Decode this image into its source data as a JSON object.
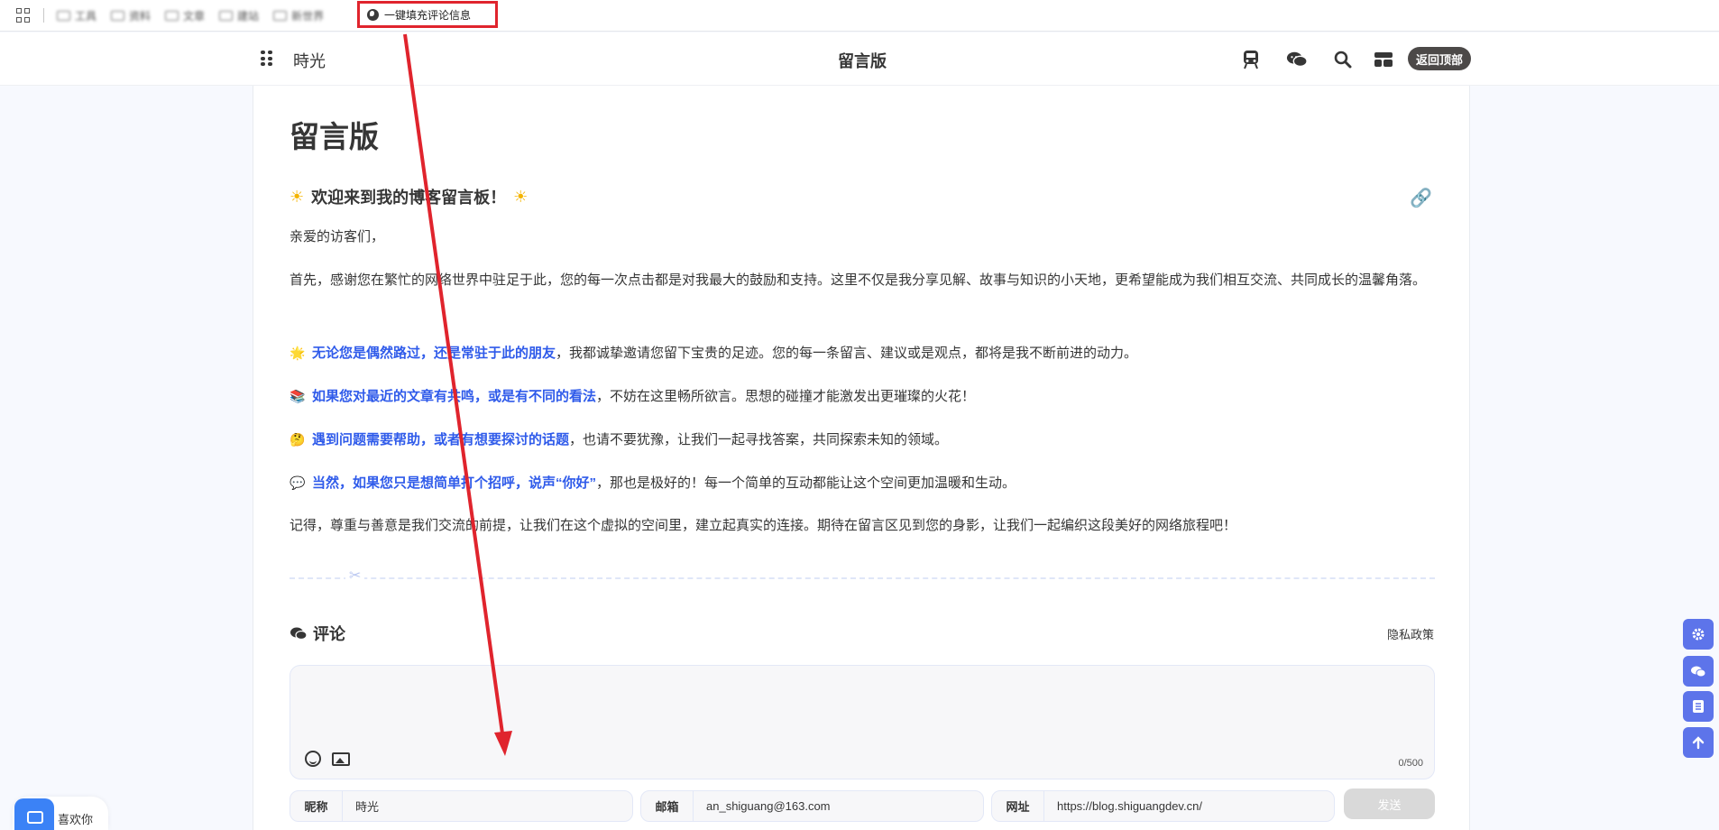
{
  "bookmarks": {
    "blurred_items": [
      "工具",
      "资料",
      "文章",
      "建站",
      "新世界"
    ],
    "fill_button_label": "一键填充评论信息"
  },
  "nav": {
    "brand": "時光",
    "title": "留言版",
    "top_button": "返回顶部"
  },
  "content": {
    "page_title": "留言版",
    "heading": "欢迎来到我的博客留言板！",
    "greeting": "亲爱的访客们，",
    "intro": "首先，感谢您在繁忙的网络世界中驻足于此，您的每一次点击都是对我最大的鼓励和支持。这里不仅是我分享见解、故事与知识的小天地，更希望能成为我们相互交流、共同成长的温馨角落。",
    "items": [
      {
        "icon": "🌟",
        "em": "无论您是偶然路过，还是常驻于此的朋友",
        "rest": "，我都诚挚邀请您留下宝贵的足迹。您的每一条留言、建议或是观点，都将是我不断前进的动力。"
      },
      {
        "icon": "📚",
        "em": "如果您对最近的文章有共鸣，或是有不同的看法",
        "rest": "，不妨在这里畅所欲言。思想的碰撞才能激发出更璀璨的火花！"
      },
      {
        "icon": "🤔",
        "em": "遇到问题需要帮助，或者有想要探讨的话题",
        "rest": "，也请不要犹豫，让我们一起寻找答案，共同探索未知的领域。"
      },
      {
        "icon": "💬",
        "em": "当然，如果您只是想简单打个招呼，说声“你好”",
        "rest": "，那也是极好的！每一个简单的互动都能让这个空间更加温暖和生动。"
      }
    ],
    "closing": "记得，尊重与善意是我们交流的前提，让我们在这个虚拟的空间里，建立起真实的连接。期待在留言区见到您的身影，让我们一起编织这段美好的网络旅程吧！"
  },
  "comments": {
    "title": "评论",
    "privacy": "隐私政策",
    "counter": "0/500",
    "nickname_label": "昵称",
    "nickname_value": "時光",
    "email_label": "邮箱",
    "email_value": "an_shiguang@163.com",
    "url_label": "网址",
    "url_value": "https://blog.shiguangdev.cn/",
    "send_label": "发送"
  },
  "widget": {
    "label": "喜欢你"
  },
  "colors": {
    "accent": "#2f5bea",
    "fab": "#5d74ea",
    "annotation": "#e0242d"
  }
}
